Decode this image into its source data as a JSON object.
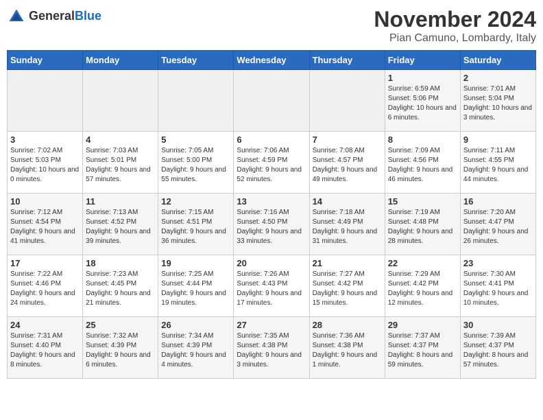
{
  "logo": {
    "general": "General",
    "blue": "Blue"
  },
  "header": {
    "month": "November 2024",
    "location": "Pian Camuno, Lombardy, Italy"
  },
  "weekdays": [
    "Sunday",
    "Monday",
    "Tuesday",
    "Wednesday",
    "Thursday",
    "Friday",
    "Saturday"
  ],
  "weeks": [
    [
      {
        "day": "",
        "info": ""
      },
      {
        "day": "",
        "info": ""
      },
      {
        "day": "",
        "info": ""
      },
      {
        "day": "",
        "info": ""
      },
      {
        "day": "",
        "info": ""
      },
      {
        "day": "1",
        "info": "Sunrise: 6:59 AM\nSunset: 5:06 PM\nDaylight: 10 hours and 6 minutes."
      },
      {
        "day": "2",
        "info": "Sunrise: 7:01 AM\nSunset: 5:04 PM\nDaylight: 10 hours and 3 minutes."
      }
    ],
    [
      {
        "day": "3",
        "info": "Sunrise: 7:02 AM\nSunset: 5:03 PM\nDaylight: 10 hours and 0 minutes."
      },
      {
        "day": "4",
        "info": "Sunrise: 7:03 AM\nSunset: 5:01 PM\nDaylight: 9 hours and 57 minutes."
      },
      {
        "day": "5",
        "info": "Sunrise: 7:05 AM\nSunset: 5:00 PM\nDaylight: 9 hours and 55 minutes."
      },
      {
        "day": "6",
        "info": "Sunrise: 7:06 AM\nSunset: 4:59 PM\nDaylight: 9 hours and 52 minutes."
      },
      {
        "day": "7",
        "info": "Sunrise: 7:08 AM\nSunset: 4:57 PM\nDaylight: 9 hours and 49 minutes."
      },
      {
        "day": "8",
        "info": "Sunrise: 7:09 AM\nSunset: 4:56 PM\nDaylight: 9 hours and 46 minutes."
      },
      {
        "day": "9",
        "info": "Sunrise: 7:11 AM\nSunset: 4:55 PM\nDaylight: 9 hours and 44 minutes."
      }
    ],
    [
      {
        "day": "10",
        "info": "Sunrise: 7:12 AM\nSunset: 4:54 PM\nDaylight: 9 hours and 41 minutes."
      },
      {
        "day": "11",
        "info": "Sunrise: 7:13 AM\nSunset: 4:52 PM\nDaylight: 9 hours and 39 minutes."
      },
      {
        "day": "12",
        "info": "Sunrise: 7:15 AM\nSunset: 4:51 PM\nDaylight: 9 hours and 36 minutes."
      },
      {
        "day": "13",
        "info": "Sunrise: 7:16 AM\nSunset: 4:50 PM\nDaylight: 9 hours and 33 minutes."
      },
      {
        "day": "14",
        "info": "Sunrise: 7:18 AM\nSunset: 4:49 PM\nDaylight: 9 hours and 31 minutes."
      },
      {
        "day": "15",
        "info": "Sunrise: 7:19 AM\nSunset: 4:48 PM\nDaylight: 9 hours and 28 minutes."
      },
      {
        "day": "16",
        "info": "Sunrise: 7:20 AM\nSunset: 4:47 PM\nDaylight: 9 hours and 26 minutes."
      }
    ],
    [
      {
        "day": "17",
        "info": "Sunrise: 7:22 AM\nSunset: 4:46 PM\nDaylight: 9 hours and 24 minutes."
      },
      {
        "day": "18",
        "info": "Sunrise: 7:23 AM\nSunset: 4:45 PM\nDaylight: 9 hours and 21 minutes."
      },
      {
        "day": "19",
        "info": "Sunrise: 7:25 AM\nSunset: 4:44 PM\nDaylight: 9 hours and 19 minutes."
      },
      {
        "day": "20",
        "info": "Sunrise: 7:26 AM\nSunset: 4:43 PM\nDaylight: 9 hours and 17 minutes."
      },
      {
        "day": "21",
        "info": "Sunrise: 7:27 AM\nSunset: 4:42 PM\nDaylight: 9 hours and 15 minutes."
      },
      {
        "day": "22",
        "info": "Sunrise: 7:29 AM\nSunset: 4:42 PM\nDaylight: 9 hours and 12 minutes."
      },
      {
        "day": "23",
        "info": "Sunrise: 7:30 AM\nSunset: 4:41 PM\nDaylight: 9 hours and 10 minutes."
      }
    ],
    [
      {
        "day": "24",
        "info": "Sunrise: 7:31 AM\nSunset: 4:40 PM\nDaylight: 9 hours and 8 minutes."
      },
      {
        "day": "25",
        "info": "Sunrise: 7:32 AM\nSunset: 4:39 PM\nDaylight: 9 hours and 6 minutes."
      },
      {
        "day": "26",
        "info": "Sunrise: 7:34 AM\nSunset: 4:39 PM\nDaylight: 9 hours and 4 minutes."
      },
      {
        "day": "27",
        "info": "Sunrise: 7:35 AM\nSunset: 4:38 PM\nDaylight: 9 hours and 3 minutes."
      },
      {
        "day": "28",
        "info": "Sunrise: 7:36 AM\nSunset: 4:38 PM\nDaylight: 9 hours and 1 minute."
      },
      {
        "day": "29",
        "info": "Sunrise: 7:37 AM\nSunset: 4:37 PM\nDaylight: 8 hours and 59 minutes."
      },
      {
        "day": "30",
        "info": "Sunrise: 7:39 AM\nSunset: 4:37 PM\nDaylight: 8 hours and 57 minutes."
      }
    ]
  ]
}
